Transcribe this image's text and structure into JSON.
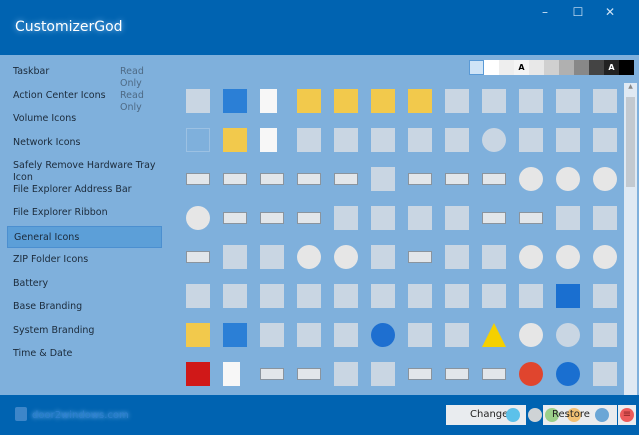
{
  "window": {
    "title": "CustomizerGod",
    "minimize": "–",
    "maximize": "☐",
    "close": "✕"
  },
  "sidebar": {
    "items": [
      {
        "label": "Taskbar",
        "badge": "Read Only"
      },
      {
        "label": "Action Center Icons",
        "badge": "Read Only"
      },
      {
        "label": "Volume Icons"
      },
      {
        "label": "Network Icons"
      },
      {
        "label": "Safely Remove Hardware Tray Icon"
      },
      {
        "label": "File Explorer Address Bar"
      },
      {
        "label": "File Explorer Ribbon"
      },
      {
        "label": "General Icons",
        "selected": true
      },
      {
        "label": "ZIP Folder Icons"
      },
      {
        "label": "Battery"
      },
      {
        "label": "Base Branding"
      },
      {
        "label": "System Branding"
      },
      {
        "label": "Time & Date"
      }
    ]
  },
  "swatches": [
    {
      "color": "#cfe4f7",
      "text": ""
    },
    {
      "color": "#ffffff",
      "text": ""
    },
    {
      "color": "#eeeeee",
      "text": ""
    },
    {
      "color": "#f4f4f4",
      "text": "A"
    },
    {
      "color": "#e8e8e8",
      "text": ""
    },
    {
      "color": "#d0d0d0",
      "text": ""
    },
    {
      "color": "#b0b0b0",
      "text": ""
    },
    {
      "color": "#888888",
      "text": ""
    },
    {
      "color": "#444444",
      "text": ""
    },
    {
      "color": "#222222",
      "text": "A"
    },
    {
      "color": "#000000",
      "text": ""
    }
  ],
  "icons": [
    [
      "monitor",
      "shield",
      "document",
      "folder",
      "folder",
      "folder",
      "folder-narrow",
      "blue-cube",
      "blue-cube",
      "blue-shard",
      "cards",
      "window"
    ],
    [
      "blank",
      "folder-doc",
      "document-lines",
      "envelope",
      "picture",
      "film-doc",
      "film",
      "network-check",
      "globe",
      "printer",
      "monitor-doc",
      "printer"
    ],
    [
      "drive",
      "drive-disc",
      "drive-x",
      "drive",
      "drive-green",
      "chip",
      "drive",
      "drive-win",
      "drive-dvd",
      "disc-dvd-r",
      "disc-dvd-ram",
      "disc-dvd-rom"
    ],
    [
      "disc-dvd-rw",
      "drive",
      "drive",
      "drive-cyl",
      "network-printer",
      "camera",
      "phone",
      "media-check",
      "drive-check",
      "drive-check",
      "scanner",
      "media"
    ],
    [
      "drive-green",
      "recycle-bin",
      "recycle-bin",
      "disc",
      "disc-dvd",
      "camera",
      "drive",
      "lock",
      "memory-card",
      "disc",
      "disc-cd-r",
      "disc-cd-rom"
    ],
    [
      "id-card",
      "phone-user",
      "doc-gear",
      "monitor-doc",
      "doc-gear",
      "photo",
      "photo",
      "photo",
      "network-user",
      "network-user",
      "help-drive",
      "printer"
    ],
    [
      "folder-font",
      "shield",
      "users",
      "checklist",
      "server",
      "info",
      "key",
      "photos",
      "warning",
      "disc-music",
      "clock",
      "printer-gear"
    ],
    [
      "x-red",
      "document",
      "drive",
      "drive",
      "tablet",
      "connector",
      "drive",
      "drive",
      "drive",
      "error",
      "help",
      "users"
    ]
  ],
  "icon_colors": {
    "folder": "#f2c94c",
    "document": "#f7f7f7",
    "drive": "#e2e6ea",
    "disc": "#e6e6e6",
    "shield": "#2b7fd6",
    "info": "#1e6fd0",
    "warning": "#f5d000",
    "x-red": "#d01818",
    "error": "#e0452e",
    "help": "#1a6fd0",
    "default": "#c9d6e3"
  },
  "scrollbar": {
    "up": "▲",
    "position": 0.0
  },
  "footer": {
    "site": "door2windows.com",
    "change": "Change",
    "restore": "Restore",
    "menu": "≡"
  }
}
